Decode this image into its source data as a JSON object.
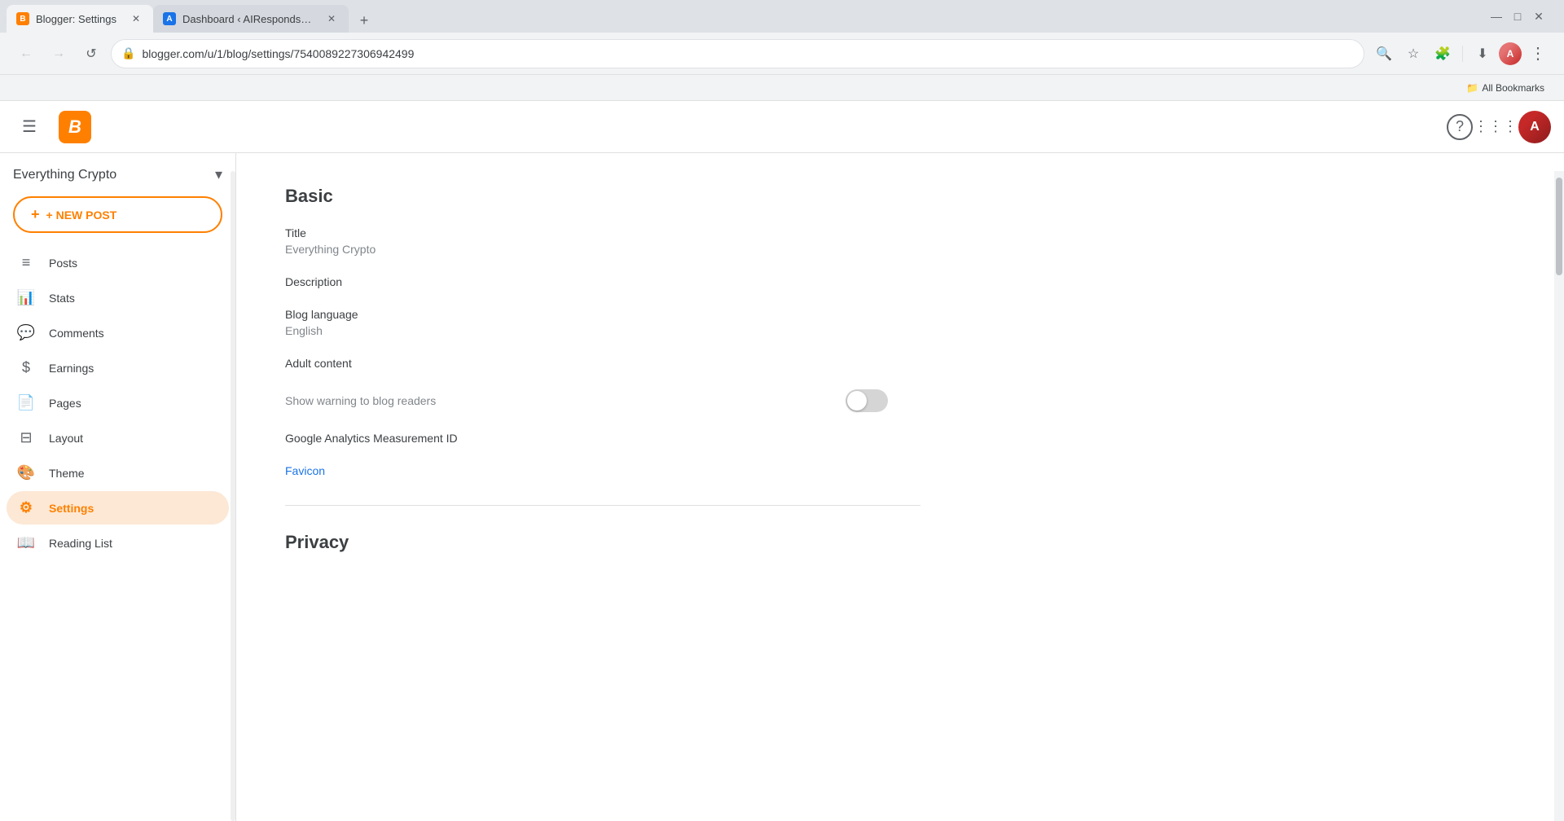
{
  "browser": {
    "tabs": [
      {
        "id": "tab-blogger-settings",
        "favicon_type": "blogger",
        "favicon_label": "B",
        "label": "Blogger: Settings",
        "active": true
      },
      {
        "id": "tab-dashboard",
        "favicon_type": "dashboard",
        "favicon_label": "A",
        "label": "Dashboard ‹ AIRespondsBlog …",
        "active": false
      }
    ],
    "url": "blogger.com/u/1/blog/settings/7540089227306942499",
    "new_tab_label": "+",
    "minimize_icon": "—",
    "maximize_icon": "□",
    "close_icon": "✕",
    "back_icon": "←",
    "forward_icon": "→",
    "reload_icon": "↺",
    "search_icon": "🔍",
    "bookmark_icon": "☆",
    "extensions_icon": "🧩",
    "download_icon": "⬇",
    "bookmarks_bar": {
      "label": "All Bookmarks",
      "folder_icon": "📁"
    }
  },
  "blogger": {
    "logo_letter": "B",
    "hamburger_icon": "☰",
    "help_icon": "?",
    "apps_icon": "⋮⋮⋮",
    "blog_name": "Everything Crypto",
    "chevron_icon": "▾",
    "new_post_label": "+ NEW POST",
    "nav_items": [
      {
        "id": "posts",
        "icon": "≡",
        "label": "Posts"
      },
      {
        "id": "stats",
        "icon": "📊",
        "label": "Stats"
      },
      {
        "id": "comments",
        "icon": "💬",
        "label": "Comments"
      },
      {
        "id": "earnings",
        "icon": "$",
        "label": "Earnings"
      },
      {
        "id": "pages",
        "icon": "📄",
        "label": "Pages"
      },
      {
        "id": "layout",
        "icon": "⊟",
        "label": "Layout"
      },
      {
        "id": "theme",
        "icon": "🎨",
        "label": "Theme"
      },
      {
        "id": "settings",
        "icon": "⚙",
        "label": "Settings",
        "active": true
      },
      {
        "id": "reading-list",
        "icon": "📖",
        "label": "Reading List"
      }
    ]
  },
  "settings": {
    "page_title": "Basic",
    "sections": [
      {
        "id": "basic",
        "title": "Basic",
        "fields": [
          {
            "id": "title",
            "label": "Title",
            "value": "Everything Crypto",
            "type": "text"
          },
          {
            "id": "description",
            "label": "Description",
            "value": "",
            "type": "text"
          },
          {
            "id": "blog-language",
            "label": "Blog language",
            "value": "English",
            "type": "text"
          },
          {
            "id": "adult-content",
            "label": "Adult content",
            "value": "",
            "type": "section"
          },
          {
            "id": "show-warning",
            "label": "Show warning to blog readers",
            "value": "",
            "type": "toggle",
            "toggle_on": false
          },
          {
            "id": "analytics",
            "label": "Google Analytics Measurement ID",
            "value": "",
            "type": "text"
          },
          {
            "id": "favicon",
            "label": "Favicon",
            "value": "",
            "type": "link"
          }
        ]
      },
      {
        "id": "privacy",
        "title": "Privacy",
        "fields": []
      }
    ]
  }
}
